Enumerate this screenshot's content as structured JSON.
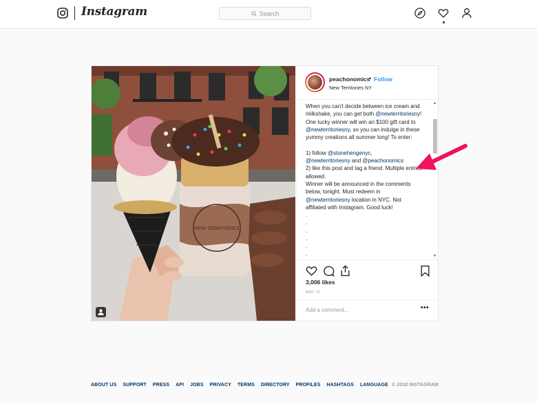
{
  "nav": {
    "wordmark": "Instagram",
    "search_placeholder": "Search",
    "icons": [
      "instagram-glyph-icon",
      "compass-icon",
      "heart-icon",
      "profile-icon"
    ]
  },
  "post": {
    "username": "peachonomics",
    "separator": "•",
    "follow_label": "Follow",
    "location": "New Territories NY",
    "caption": {
      "p1a": "When you can't decide between ice cream and milkshake, you can get both ",
      "m1": "@newterritoriesny",
      "p1b": "! One lucky winner will win an $100 gift card to ",
      "m2": "@newterritoriesny",
      "p1c": ", so you can indulge in these yummy creations all summer long! To enter:\n\n1) follow ",
      "m3": "@stonehengenyc",
      "p2a": ",\n",
      "m4": "@newterritoriesny",
      "p2b": " and ",
      "m5": "@peachonomics",
      "p2c": "\n2) like this post and tag a friend. Multiple entries allowed.\nWinner will be announced in the comments below, tonight. Must redeem in ",
      "m6": "@newterritoriesny",
      "p3": " location in NYC. Not affiliated with Instagram. Good luck!\n.\n.\n.\n.\n.\n."
    },
    "likes": "3,006 likes",
    "date": "MAY 11",
    "comment_placeholder": "Add a comment...",
    "more_label": "•••",
    "photo_sign_text": "NEW TERRITORIES"
  },
  "footer": {
    "links": [
      "ABOUT US",
      "SUPPORT",
      "PRESS",
      "API",
      "JOBS",
      "PRIVACY",
      "TERMS",
      "DIRECTORY",
      "PROFILES",
      "HASHTAGS",
      "LANGUAGE"
    ],
    "copyright": "© 2018 INSTAGRAM"
  },
  "colors": {
    "link_blue": "#3897f0",
    "mention_navy": "#003569",
    "annotation_arrow": "#f0145a"
  }
}
